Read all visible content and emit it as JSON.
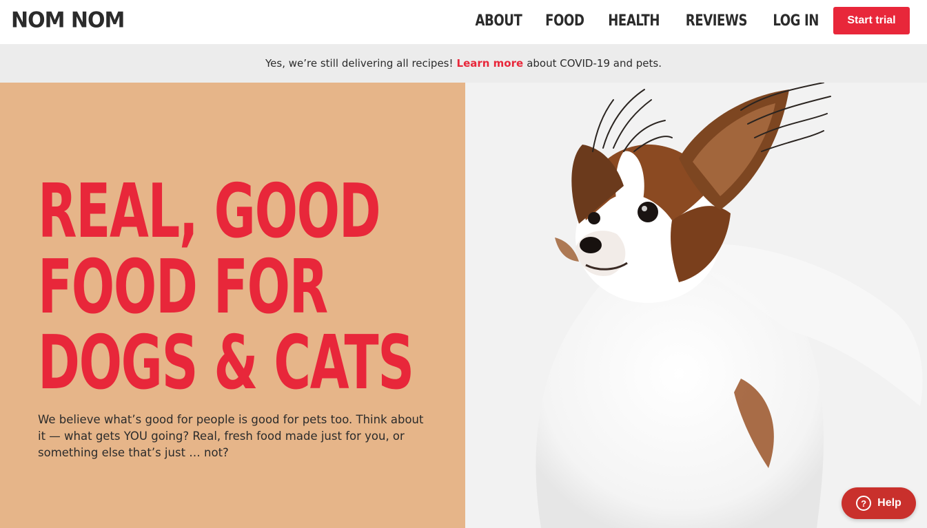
{
  "header": {
    "logo": "NOM NOM",
    "nav": [
      "ABOUT",
      "FOOD",
      "HEALTH",
      "REVIEWS",
      "LOG IN"
    ],
    "cta": "Start trial"
  },
  "banner": {
    "prefix": "Yes, we’re still delivering all recipes!",
    "link": "Learn more",
    "suffix": "about COVID-19 and pets."
  },
  "hero": {
    "headline": [
      "REAL, GOOD",
      "FOOD FOR",
      "DOGS & CATS"
    ],
    "body": "We believe what’s good for people is good for pets too. Think about it — what gets YOU going? Real, fresh food made just for you, or something else that’s just … not?",
    "image": "papillon-dog-photo"
  },
  "help": {
    "label": "Help",
    "icon": "question-icon"
  },
  "colors": {
    "brand_red": "#e8273a",
    "hero_tan": "#e6b589",
    "banner_gray": "#ececec",
    "help_red": "#c9302c"
  }
}
